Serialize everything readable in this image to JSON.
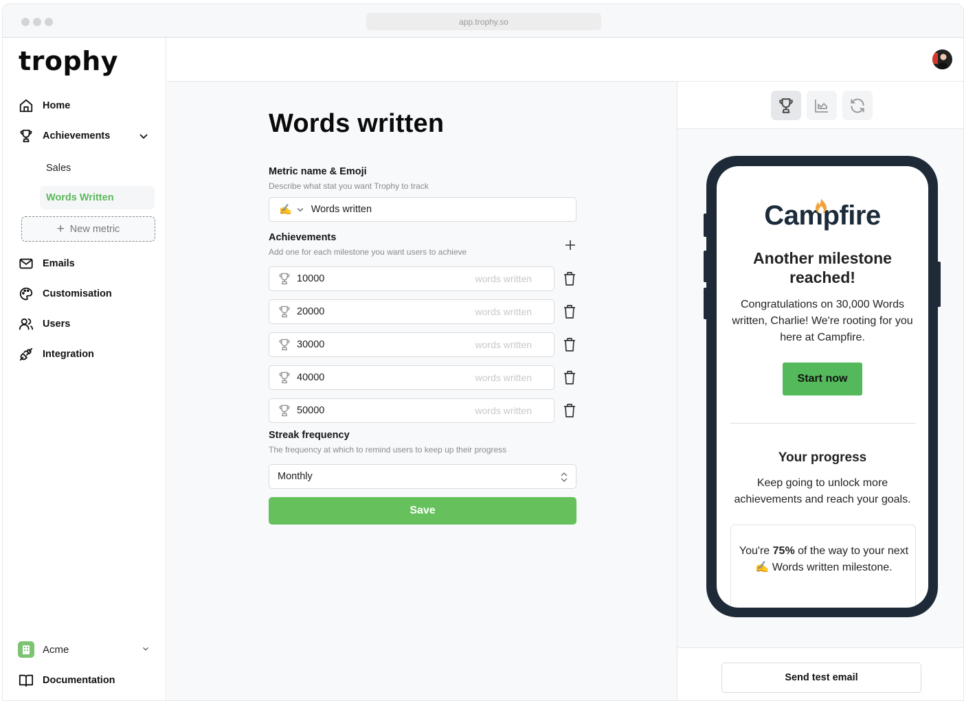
{
  "browser": {
    "url": "app.trophy.so"
  },
  "sidebar": {
    "logo": "trophy",
    "items": [
      {
        "label": "Home",
        "icon": "home-icon"
      },
      {
        "label": "Achievements",
        "icon": "trophy-icon",
        "expanded": true
      },
      {
        "label": "Emails",
        "icon": "mail-icon"
      },
      {
        "label": "Customisation",
        "icon": "palette-icon"
      },
      {
        "label": "Users",
        "icon": "users-icon"
      },
      {
        "label": "Integration",
        "icon": "plug-icon"
      }
    ],
    "sub_items": [
      {
        "label": "Sales",
        "active": false
      },
      {
        "label": "Words Written",
        "active": true
      }
    ],
    "new_metric_label": "New metric",
    "org": {
      "name": "Acme",
      "icon": "building-icon"
    },
    "documentation_label": "Documentation"
  },
  "main": {
    "title": "Words written",
    "metric": {
      "label": "Metric name & Emoji",
      "help": "Describe what stat you want Trophy to track",
      "emoji": "✍️",
      "value": "Words written"
    },
    "achievements": {
      "label": "Achievements",
      "help": "Add one for each milestone you want users to achieve",
      "unit": "words written",
      "items": [
        {
          "value": "10000"
        },
        {
          "value": "20000"
        },
        {
          "value": "30000"
        },
        {
          "value": "40000"
        },
        {
          "value": "50000"
        }
      ]
    },
    "streak": {
      "label": "Streak frequency",
      "help": "The frequency at which to remind users to keep up their progress",
      "value": "Monthly"
    },
    "save_label": "Save"
  },
  "preview": {
    "tabs": [
      {
        "name": "achievements",
        "icon": "trophy-icon",
        "active": true
      },
      {
        "name": "metrics",
        "icon": "chart-icon",
        "active": false
      },
      {
        "name": "streaks",
        "icon": "refresh-icon",
        "active": false
      }
    ],
    "email": {
      "brand": "Campfire",
      "heading": "Another milestone reached!",
      "body": "Congratulations on 30,000 Words written, Charlie! We're rooting for you here at Campfire.",
      "cta": "Start now",
      "progress_heading": "Your progress",
      "progress_body": "Keep going to unlock more achievements and reach your goals.",
      "progress_prefix": "You're ",
      "progress_percent": "75%",
      "progress_suffix": " of the way to your next ✍️ Words written milestone."
    },
    "send_test_label": "Send test email"
  },
  "colors": {
    "accent": "#66c15d",
    "active_text": "#5cb85c",
    "phone_frame": "#1e2a38",
    "brand_flame": "#f0a33c"
  }
}
